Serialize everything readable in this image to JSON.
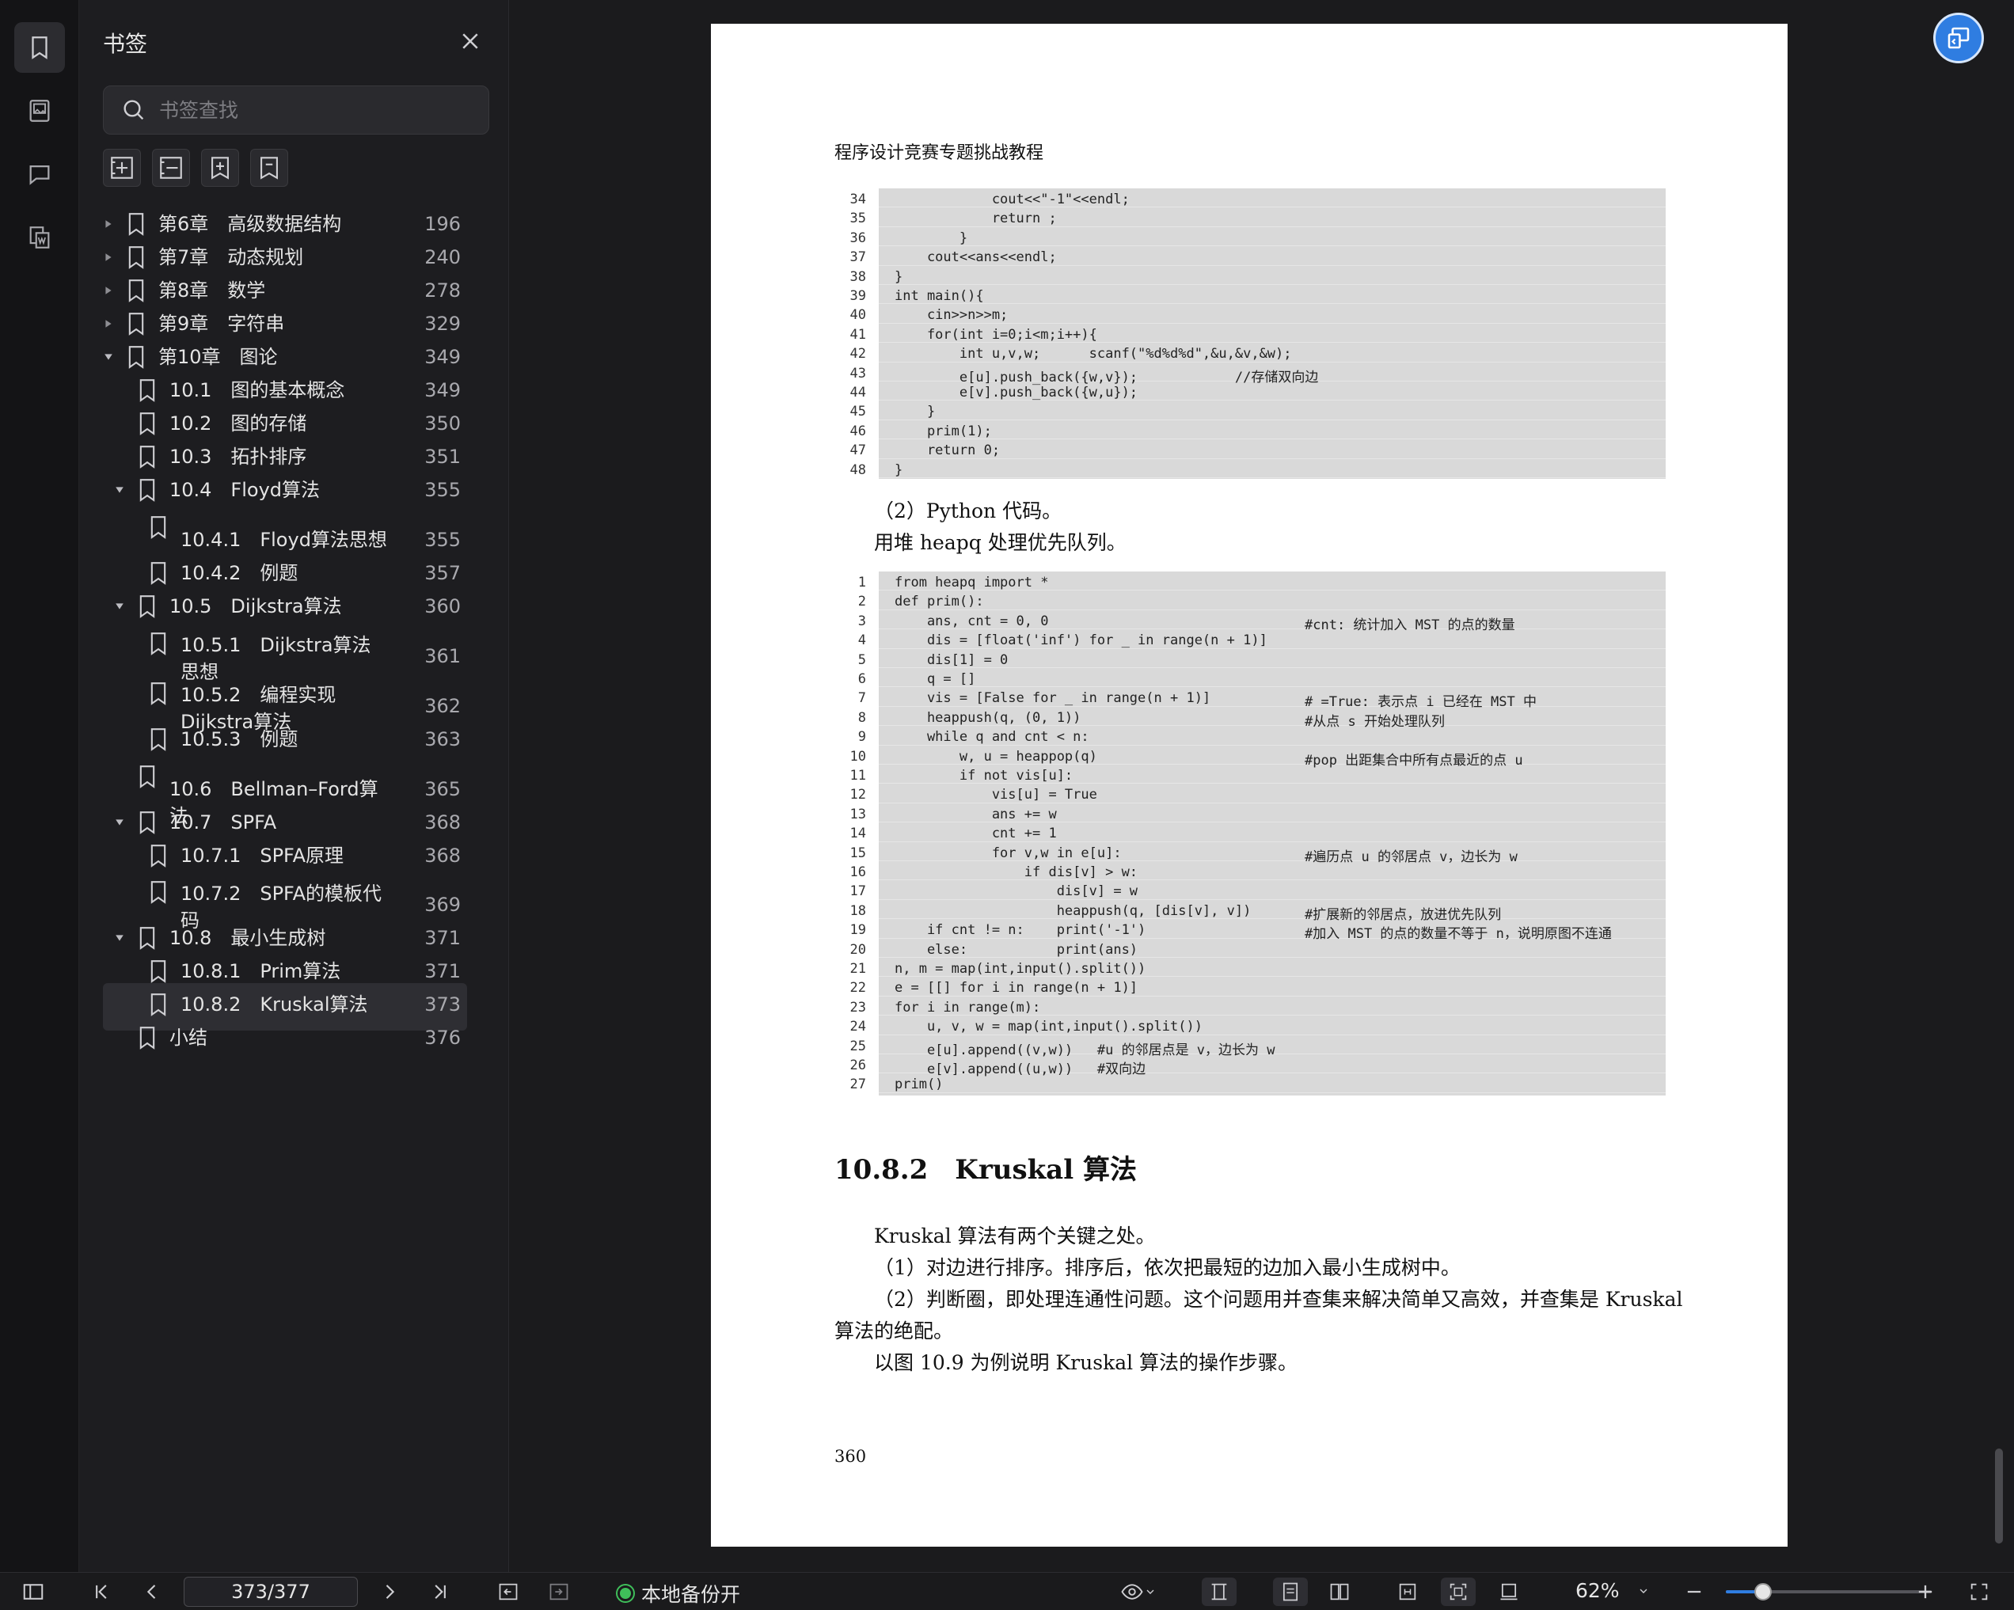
{
  "panel": {
    "title": "书签",
    "search_placeholder": "书签查找"
  },
  "bookmarks": [
    {
      "label": "第6章　高级数据结构",
      "page": "196",
      "level": 0,
      "toggle": "collapsed"
    },
    {
      "label": "第7章　动态规划",
      "page": "240",
      "level": 0,
      "toggle": "collapsed"
    },
    {
      "label": "第8章　数学",
      "page": "278",
      "level": 0,
      "toggle": "collapsed"
    },
    {
      "label": "第9章　字符串",
      "page": "329",
      "level": 0,
      "toggle": "collapsed"
    },
    {
      "label": "第10章　图论",
      "page": "349",
      "level": 0,
      "toggle": "expanded"
    },
    {
      "label": "10.1　图的基本概念",
      "page": "349",
      "level": 1,
      "toggle": "none"
    },
    {
      "label": "10.2　图的存储",
      "page": "350",
      "level": 1,
      "toggle": "none"
    },
    {
      "label": "10.3　拓扑排序",
      "page": "351",
      "level": 1,
      "toggle": "none"
    },
    {
      "label": "10.4　Floyd算法",
      "page": "355",
      "level": 1,
      "toggle": "expanded"
    },
    {
      "label": "10.4.1　Floyd算法思想",
      "page": "355",
      "level": 2,
      "toggle": "none"
    },
    {
      "label": "10.4.2　例题",
      "page": "357",
      "level": 2,
      "toggle": "none"
    },
    {
      "label": "10.5　Dijkstra算法",
      "page": "360",
      "level": 1,
      "toggle": "expanded"
    },
    {
      "label": "10.5.1　Dijkstra算法思想",
      "page": "361",
      "level": 2,
      "toggle": "none"
    },
    {
      "label": "10.5.2　编程实现Dijkstra算法",
      "page": "362",
      "level": 2,
      "toggle": "none"
    },
    {
      "label": "10.5.3　例题",
      "page": "363",
      "level": 2,
      "toggle": "none"
    },
    {
      "label": "10.6　Bellman–Ford算法",
      "page": "365",
      "level": 1,
      "toggle": "none"
    },
    {
      "label": "10.7　SPFA",
      "page": "368",
      "level": 1,
      "toggle": "expanded"
    },
    {
      "label": "10.7.1　SPFA原理",
      "page": "368",
      "level": 2,
      "toggle": "none"
    },
    {
      "label": "10.7.2　SPFA的模板代码",
      "page": "369",
      "level": 2,
      "toggle": "none"
    },
    {
      "label": "10.8　最小生成树",
      "page": "371",
      "level": 1,
      "toggle": "expanded"
    },
    {
      "label": "10.8.1　Prim算法",
      "page": "371",
      "level": 2,
      "toggle": "none"
    },
    {
      "label": "10.8.2　Kruskal算法",
      "page": "373",
      "level": 2,
      "toggle": "none",
      "selected": true
    },
    {
      "label": "小结",
      "page": "376",
      "level": 1,
      "toggle": "none"
    }
  ],
  "document": {
    "header": "程序设计竞赛专题挑战教程",
    "code1": [
      {
        "n": "34",
        "t": "            cout<<\"-1\"<<endl;"
      },
      {
        "n": "35",
        "t": "            return ;"
      },
      {
        "n": "36",
        "t": "        }"
      },
      {
        "n": "37",
        "t": "    cout<<ans<<endl;"
      },
      {
        "n": "38",
        "t": "}"
      },
      {
        "n": "39",
        "t": "int main(){"
      },
      {
        "n": "40",
        "t": "    cin>>n>>m;"
      },
      {
        "n": "41",
        "t": "    for(int i=0;i<m;i++){"
      },
      {
        "n": "42",
        "t": "        int u,v,w;      scanf(\"%d%d%d\",&u,&v,&w);"
      },
      {
        "n": "43",
        "t": "        e[u].push_back({w,v});            //存储双向边"
      },
      {
        "n": "44",
        "t": "        e[v].push_back({w,u});"
      },
      {
        "n": "45",
        "t": "    }"
      },
      {
        "n": "46",
        "t": "    prim(1);"
      },
      {
        "n": "47",
        "t": "    return 0;"
      },
      {
        "n": "48",
        "t": "}"
      }
    ],
    "para_python": "（2）Python 代码。",
    "para_heapq": "用堆 heapq 处理优先队列。",
    "code2": [
      {
        "n": "1",
        "t": "from heapq import *",
        "c": ""
      },
      {
        "n": "2",
        "t": "def prim():",
        "c": ""
      },
      {
        "n": "3",
        "t": "    ans, cnt = 0, 0",
        "c": "#cnt: 统计加入 MST 的点的数量"
      },
      {
        "n": "4",
        "t": "    dis = [float('inf') for _ in range(n + 1)]",
        "c": ""
      },
      {
        "n": "5",
        "t": "    dis[1] = 0",
        "c": ""
      },
      {
        "n": "6",
        "t": "    q = []",
        "c": ""
      },
      {
        "n": "7",
        "t": "    vis = [False for _ in range(n + 1)]",
        "c": "# =True: 表示点 i 已经在 MST 中"
      },
      {
        "n": "8",
        "t": "    heappush(q, (0, 1))",
        "c": "#从点 s 开始处理队列"
      },
      {
        "n": "9",
        "t": "    while q and cnt < n:",
        "c": ""
      },
      {
        "n": "10",
        "t": "        w, u = heappop(q)",
        "c": "#pop 出距集合中所有点最近的点 u"
      },
      {
        "n": "11",
        "t": "        if not vis[u]:",
        "c": ""
      },
      {
        "n": "12",
        "t": "            vis[u] = True",
        "c": ""
      },
      {
        "n": "13",
        "t": "            ans += w",
        "c": ""
      },
      {
        "n": "14",
        "t": "            cnt += 1",
        "c": ""
      },
      {
        "n": "15",
        "t": "            for v,w in e[u]:",
        "c": "#遍历点 u 的邻居点 v，边长为 w"
      },
      {
        "n": "16",
        "t": "                if dis[v] > w:",
        "c": ""
      },
      {
        "n": "17",
        "t": "                    dis[v] = w",
        "c": ""
      },
      {
        "n": "18",
        "t": "                    heappush(q, [dis[v], v])",
        "c": "#扩展新的邻居点，放进优先队列"
      },
      {
        "n": "19",
        "t": "    if cnt != n:    print('-1')",
        "c": "#加入 MST 的点的数量不等于 n，说明原图不连通"
      },
      {
        "n": "20",
        "t": "    else:           print(ans)",
        "c": ""
      },
      {
        "n": "21",
        "t": "n, m = map(int,input().split())",
        "c": ""
      },
      {
        "n": "22",
        "t": "e = [[] for i in range(n + 1)]",
        "c": ""
      },
      {
        "n": "23",
        "t": "for i in range(m):",
        "c": ""
      },
      {
        "n": "24",
        "t": "    u, v, w = map(int,input().split())",
        "c": ""
      },
      {
        "n": "25",
        "t": "    e[u].append((v,w))   #u 的邻居点是 v，边长为 w",
        "c": ""
      },
      {
        "n": "26",
        "t": "    e[v].append((u,w))   #双向边",
        "c": ""
      },
      {
        "n": "27",
        "t": "prim()",
        "c": ""
      }
    ],
    "section_title": "10.8.2　Kruskal 算法",
    "paragraphs": [
      "Kruskal 算法有两个关键之处。",
      "（1）对边进行排序。排序后，依次把最短的边加入最小生成树中。",
      "（2）判断圈，即处理连通性问题。这个问题用并查集来解决简单又高效，并查集是 Kruskal",
      "算法的绝配。",
      "以图 10.9 为例说明 Kruskal 算法的操作步骤。"
    ],
    "page_number": "360"
  },
  "bottombar": {
    "page_indicator": "373/377",
    "backup_label": "本地备份开",
    "zoom_label": "62%",
    "zoom_level": 0.18
  }
}
